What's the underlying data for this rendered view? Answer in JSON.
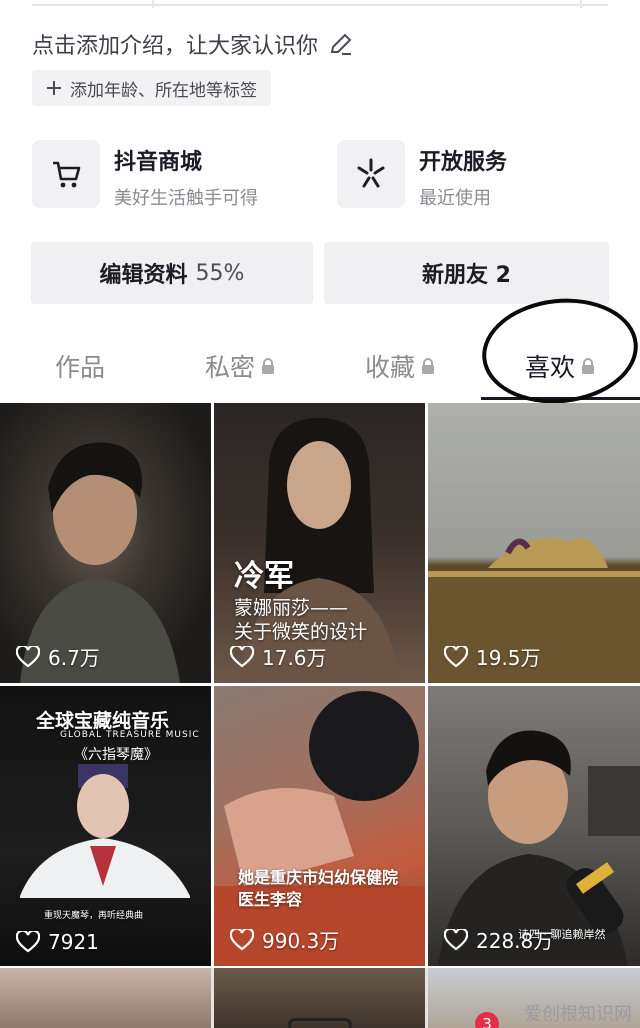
{
  "profile": {
    "bio_placeholder": "点击添加介绍，让大家认识你",
    "tag_chip": "添加年龄、所在地等标签"
  },
  "services": [
    {
      "title": "抖音商城",
      "subtitle": "美好生活触手可得",
      "icon": "cart-icon"
    },
    {
      "title": "开放服务",
      "subtitle": "最近使用",
      "icon": "asterisk-icon"
    }
  ],
  "actions": {
    "edit_label": "编辑资料",
    "edit_percent": "55%",
    "new_friends_label": "新朋友 2"
  },
  "tabs": [
    {
      "label": "作品",
      "locked": false
    },
    {
      "label": "私密",
      "locked": true
    },
    {
      "label": "收藏",
      "locked": true
    },
    {
      "label": "喜欢",
      "locked": true,
      "active": true
    }
  ],
  "videos": [
    {
      "likes": "6.7万",
      "caption": ""
    },
    {
      "likes": "17.6万",
      "caption_title": "冷军",
      "caption_sub1": "蒙娜丽莎——",
      "caption_sub2": "关于微笑的设计"
    },
    {
      "likes": "19.5万",
      "caption": ""
    },
    {
      "likes": "7921",
      "caption_title": "全球宝藏纯音乐",
      "caption_en": "GLOBAL TREASURE MUSIC",
      "caption_sub1": "《六指琴魔》",
      "caption_sub2": "重现天魔琴，再听经典曲"
    },
    {
      "likes": "990.3万",
      "caption_sub1": "她是重庆市妇幼保健院",
      "caption_sub2": "医生李容"
    },
    {
      "likes": "228.8万",
      "caption_sub1": "诗四 · 聊追赖岸然"
    }
  ],
  "bottom": {
    "badge_count": "3",
    "watermark": "爱创根知识网"
  },
  "colors": {
    "text_primary": "#161823",
    "text_secondary": "#8a8b91",
    "chip_bg": "#f1f1f3",
    "badge_red": "#e52e4a"
  }
}
